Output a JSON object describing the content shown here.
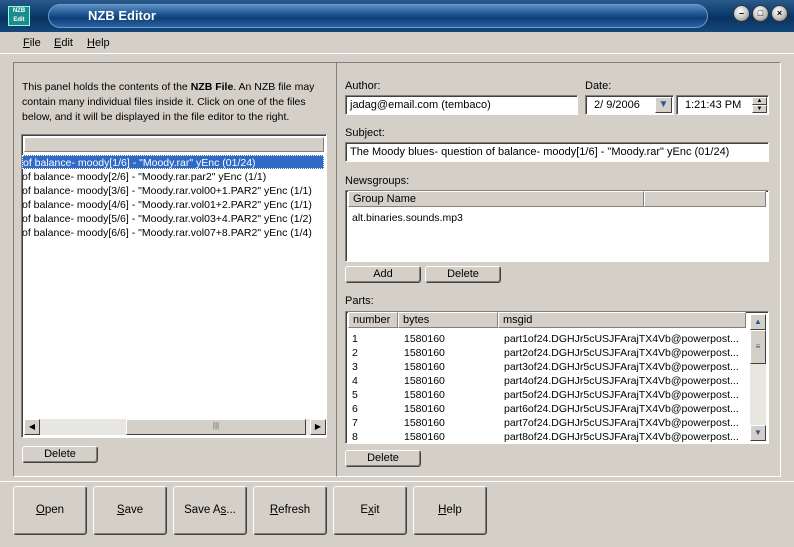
{
  "window": {
    "title": "NZB Editor",
    "icon_text": "NZB Edit",
    "controls": [
      "minimize",
      "maximize",
      "close"
    ]
  },
  "menu": [
    {
      "label": "File",
      "u": "F",
      "rest": "ile"
    },
    {
      "label": "Edit",
      "u": "E",
      "rest": "dit"
    },
    {
      "label": "Help",
      "u": "H",
      "rest": "elp"
    }
  ],
  "left_panel": {
    "desc_1": "This panel holds the contents of the ",
    "desc_bold": "NZB File",
    "desc_2": ". An NZB file may contain many individual files inside it. Click on one of the files below, and it will be displayed in the file editor to the right.",
    "files": [
      "of balance- moody[1/6] - \"Moody.rar\" yEnc (01/24)",
      "of balance- moody[2/6] - \"Moody.rar.par2\" yEnc (1/1)",
      "of balance- moody[3/6] - \"Moody.rar.vol00+1.PAR2\" yEnc (1/1)",
      "of balance- moody[4/6] - \"Moody.rar.vol01+2.PAR2\" yEnc (1/1)",
      "of balance- moody[5/6] - \"Moody.rar.vol03+4.PAR2\" yEnc (1/2)",
      "of balance- moody[6/6] - \"Moody.rar.vol07+8.PAR2\" yEnc (1/4)"
    ],
    "selected_index": 0,
    "delete_label": "Delete"
  },
  "right_panel": {
    "author_label": "Author:",
    "author_value": "jadag@email.com (tembaco)",
    "date_label": "Date:",
    "date_value": "2/ 9/2006",
    "time_value": "1:21:43 PM",
    "subject_label": "Subject:",
    "subject_value": "The Moody blues- question of balance- moody[1/6] - \"Moody.rar\" yEnc (01/24)",
    "newsgroups_label": "Newsgroups:",
    "group_header": "Group Name",
    "groups": [
      "alt.binaries.sounds.mp3"
    ],
    "add_label": "Add",
    "delete_label": "Delete",
    "parts_label": "Parts:",
    "parts_columns": [
      "number",
      "bytes",
      "msgid"
    ],
    "parts": [
      {
        "number": "1",
        "bytes": "1580160",
        "msgid": "part1of24.DGHJr5cUSJFArajTX4Vb@powerpost..."
      },
      {
        "number": "2",
        "bytes": "1580160",
        "msgid": "part2of24.DGHJr5cUSJFArajTX4Vb@powerpost..."
      },
      {
        "number": "3",
        "bytes": "1580160",
        "msgid": "part3of24.DGHJr5cUSJFArajTX4Vb@powerpost..."
      },
      {
        "number": "4",
        "bytes": "1580160",
        "msgid": "part4of24.DGHJr5cUSJFArajTX4Vb@powerpost..."
      },
      {
        "number": "5",
        "bytes": "1580160",
        "msgid": "part5of24.DGHJr5cUSJFArajTX4Vb@powerpost..."
      },
      {
        "number": "6",
        "bytes": "1580160",
        "msgid": "part6of24.DGHJr5cUSJFArajTX4Vb@powerpost..."
      },
      {
        "number": "7",
        "bytes": "1580160",
        "msgid": "part7of24.DGHJr5cUSJFArajTX4Vb@powerpost..."
      },
      {
        "number": "8",
        "bytes": "1580160",
        "msgid": "part8of24.DGHJr5cUSJFArajTX4Vb@powerpost..."
      }
    ],
    "parts_delete_label": "Delete"
  },
  "bottom_buttons": [
    {
      "name": "open",
      "u": "O",
      "rest": "pen"
    },
    {
      "name": "save",
      "u": "S",
      "rest": "ave"
    },
    {
      "name": "save-as",
      "pre": "Save A",
      "u": "s",
      "rest": "..."
    },
    {
      "name": "refresh",
      "u": "R",
      "rest": "efresh"
    },
    {
      "name": "exit",
      "pre": "E",
      "u": "x",
      "rest": "it"
    },
    {
      "name": "help",
      "u": "H",
      "rest": "elp"
    }
  ],
  "colors": {
    "selection": "#316ac5",
    "title_dark": "#0c3c6e",
    "face": "#d4d0c8"
  }
}
